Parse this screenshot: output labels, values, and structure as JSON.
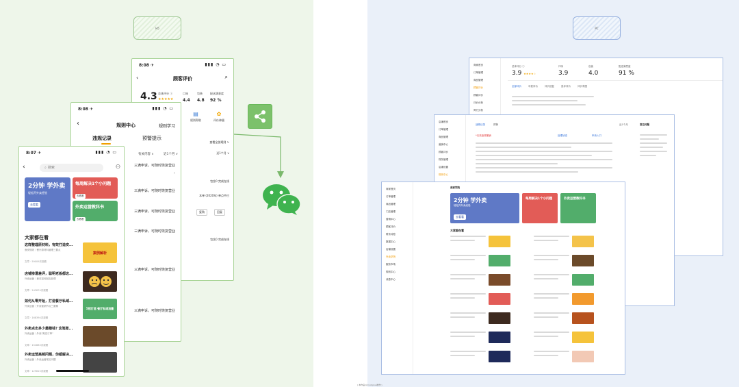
{
  "left": {
    "caption": "H5",
    "phone_reviews": {
      "status_time": "8:08 ✈",
      "title": "顾客评价",
      "overall_score": "4.3",
      "overall_label": "总体评分 ⓘ",
      "taste_label": "口味",
      "taste_value": "4.4",
      "pack_label": "包装",
      "pack_value": "4.8",
      "delivery_label": "配送满意度",
      "delivery_value": "92 %",
      "action_1": "规则帮助",
      "action_2": "评价神器",
      "side_1": "查看全部规则 >",
      "side_2": "近1个月 ∨",
      "side_3": "包含0 完成在线",
      "side_4": "本单 (2020年) 单点不已",
      "btn_1": "复购",
      "btn_2": "回复",
      "side_5": "包含0 完成在线"
    },
    "phone_rules": {
      "status_time": "8:08 ✈",
      "title": "规则中心",
      "learn": "规则学习",
      "tab_active": "违规记录",
      "tab_other": "预警提示",
      "filter_1": "有关内容 ∨",
      "filter_2": "近1个月 ∨",
      "rule_lines": [
        "三满申诉，可随时恢复营业",
        "三满申诉，可随时恢复营业",
        "三满申诉，可随时恢复营业",
        "三满申诉，可随时恢复营业",
        "三满申诉，可随时恢复营业",
        "三满申诉，可随时恢复营业"
      ]
    },
    "phone_main": {
      "status_time": "8:07 ✈",
      "search_placeholder": "搜索",
      "banner_blue_title": "2分钟 学外卖",
      "banner_blue_sub": "轻松开外卖经验",
      "banner_blue_btn": "去看看",
      "banner_red_title": "每周解决1个小问题",
      "banner_red_btn": "去看看",
      "banner_green_title": "外卖运营教科书",
      "banner_green_btn": "去看看",
      "section_title": "大家都在看",
      "articles": [
        {
          "title": "这样整理原材料，有效打造安...",
          "sub": "食安规则｜餐厅原材料管理三要点",
          "count": "文章 · 59009次观看",
          "thumb_text": "案例解析"
        },
        {
          "title": "店铺惨遭差评，聪明老板都这...",
          "sub": "外卖运营｜差评如何回应处理",
          "count": "文章 · 243874次观看",
          "thumb_text": ""
        },
        {
          "title": "如何从零开始，打造餐厅私域...",
          "sub": "外卖运营｜外卖营销节点三要素",
          "count": "文章 · 168394次观看",
          "thumb_text": "5招打造 餐厅私域流量"
        },
        {
          "title": "外卖点出多少最赚钱? 这笔账...",
          "sub": "外卖运营｜外卖\"离店订单\"",
          "count": "文章 · 154883次观看",
          "thumb_text": ""
        },
        {
          "title": "外卖运营高频问题，你都解决...",
          "sub": "外卖运营｜外卖运营常见问题",
          "count": "文章 · 129815次观看",
          "thumb_text": ""
        }
      ]
    }
  },
  "right": {
    "caption": "PC",
    "desk_back": {
      "nav": [
        "商家首页",
        "订单管理",
        "商品管理",
        "顾客评价",
        "顾客评价",
        "评价分析",
        "同行分析",
        "评价管理"
      ],
      "metric_1_label": "总体评分 ⓘ",
      "metric_1_value": "3.9",
      "metric_2_label": "口味",
      "metric_2_value": "3.9",
      "metric_3_label": "包装",
      "metric_3_value": "4.0",
      "metric_4_label": "配送满意度",
      "metric_4_value": "91 %",
      "tabs": [
        "全部评价",
        "中差评价",
        "评价回复",
        "追评评价",
        "评价有图"
      ]
    },
    "desk_mid": {
      "nav": [
        "店铺首页",
        "订单管理",
        "商品管理",
        "营销中心",
        "顾客评价",
        "财务管理",
        "店铺设置",
        "规则中心"
      ],
      "tab_1": "违规记录",
      "tab_2": "预警",
      "right_link": "近1个月",
      "faq_title": "常见问题",
      "record_label": "*天亮违规撤销",
      "status_label": "处理状态",
      "appeal_label": "申诉入口"
    },
    "desk_front": {
      "nav": [
        "商家首页",
        "订单管理",
        "商品管理",
        "门店管理",
        "营销中心",
        "顾客评价",
        "财务对账",
        "数据中心",
        "店铺设置",
        "外卖学院",
        "服务市场",
        "规则中心",
        "消息中心"
      ],
      "page_title": "商家学院",
      "banner_blue_title": "2分钟 学外卖",
      "banner_blue_sub": "轻松开外卖经验",
      "banner_blue_btn": "去看看",
      "banner_red_title": "每周解决1个小问题",
      "banner_green_title": "外卖运营教科书",
      "section_title": "大家都在看"
    },
    "footnote": "( 本作品以mockplus制作 )"
  }
}
